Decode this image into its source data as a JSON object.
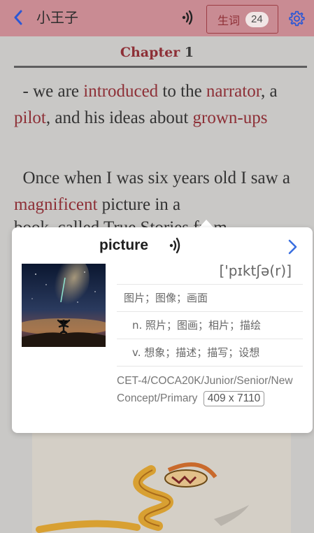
{
  "header": {
    "title": "小王子",
    "vocab_label": "生词",
    "vocab_count": "24",
    "accent_color": "#c98b93",
    "icons": [
      "back-chevron-icon",
      "audio-icon",
      "settings-gear-icon"
    ]
  },
  "reader": {
    "chapter_word": "Chapter",
    "chapter_num": "1",
    "para1": {
      "t1": "- we are ",
      "w1": "introduced",
      "t2": " to the ",
      "w2": "narrator",
      "t3": ", a ",
      "w3": "pilot",
      "t4": ", and his ideas about ",
      "w4": "grown-ups"
    },
    "para2": {
      "t1": "Once when I was six years old I saw a ",
      "w1": "magnificent",
      "t2": " picture in a"
    },
    "partial_line": "book, called True Stories from"
  },
  "popup": {
    "word": "picture",
    "phonetic": "['pɪktʃə(r)]",
    "def1": "图片；图像；画面",
    "def2": "n.  照片；图画；相片；描绘",
    "def3": "v.  想象；描述；描写；设想",
    "tags": "CET-4/COCA20K/Junior/Senior/New Concept/Primary",
    "image_size": "409 x 7110",
    "icons": [
      "audio-icon",
      "chevron-right-icon",
      "starry-sky-image"
    ]
  }
}
